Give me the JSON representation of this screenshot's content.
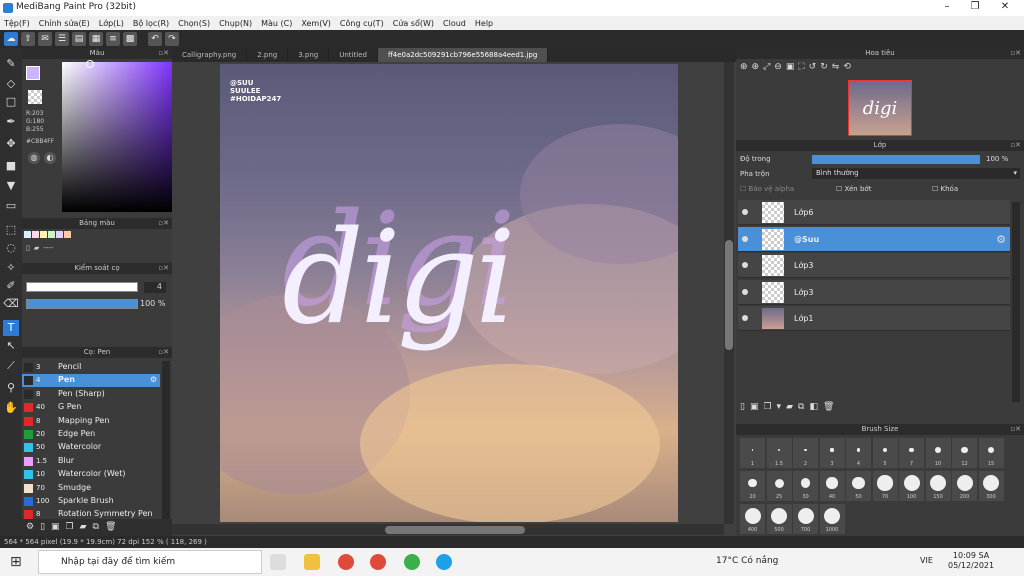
{
  "window": {
    "title": "MediBang Paint Pro (32bit)",
    "min": "–",
    "max": "❐",
    "close": "✕"
  },
  "menu": [
    "Tệp(F)",
    "Chỉnh sửa(E)",
    "Lớp(L)",
    "Bộ lọc(R)",
    "Chọn(S)",
    "Chụp(N)",
    "Màu (C)",
    "Xem(V)",
    "Công cụ(T)",
    "Cửa sổ(W)",
    "Cloud",
    "Help"
  ],
  "colorPanel": {
    "title": "Màu",
    "r": "R:203",
    "g": "G:180",
    "b": "B:255",
    "hex": "#CBB4FF",
    "fg": "#CBB4FF",
    "bg": "#F4A37A"
  },
  "palette": {
    "title": "Bảng màu",
    "colors": [
      "#d9f0ff",
      "#ffd9e8",
      "#fff3b0",
      "#c8f7c5",
      "#e2d1ff",
      "#ffc9a8"
    ],
    "more": "----"
  },
  "brushControl": {
    "title": "Kiểm soát cọ",
    "size": "4",
    "opacity": "100 %"
  },
  "penList": {
    "title": "Cọ: Pen",
    "items": [
      {
        "size": "3",
        "name": "Pencil",
        "color": "#2a2a2a"
      },
      {
        "size": "4",
        "name": "Pen",
        "color": "#2a2a2a"
      },
      {
        "size": "8",
        "name": "Pen (Sharp)",
        "color": "#2a2a2a"
      },
      {
        "size": "40",
        "name": "G Pen",
        "color": "#e02a2a"
      },
      {
        "size": "8",
        "name": "Mapping Pen",
        "color": "#e02a2a"
      },
      {
        "size": "20",
        "name": "Edge Pen",
        "color": "#1e9e3a"
      },
      {
        "size": "50",
        "name": "Watercolor",
        "color": "#2ec4e8"
      },
      {
        "size": "1.5",
        "name": "Blur",
        "color": "#e8a0ff"
      },
      {
        "size": "10",
        "name": "Watercolor (Wet)",
        "color": "#2ec4e8"
      },
      {
        "size": "70",
        "name": "Smudge",
        "color": "#f2e0c8"
      },
      {
        "size": "100",
        "name": "Sparkle Brush",
        "color": "#2a6ad4"
      },
      {
        "size": "8",
        "name": "Rotation Symmetry Pen",
        "color": "#e02a2a"
      }
    ]
  },
  "tabs": [
    "Calligraphy.png",
    "2.png",
    "3.png",
    "Untitled",
    "ff4e0a2dc509291cb796e55688a4eed1.jpg"
  ],
  "artwork": {
    "text": "digi",
    "watermark1": "@SUU",
    "watermark2": "SUULEE",
    "watermark3": "#HOIDAP247"
  },
  "navigator": {
    "title": "Hoa tiêu"
  },
  "layers": {
    "title": "Lớp",
    "opacityLabel": "Độ trong",
    "opacityValue": "100 %",
    "blendLabel": "Pha trộn",
    "blendValue": "Bình thường",
    "protectAlpha": "Bảo vệ alpha",
    "clipping": "Xén bớt",
    "lock": "Khóa",
    "items": [
      {
        "name": "Lớp6",
        "selected": false
      },
      {
        "name": "@Suu",
        "selected": true
      },
      {
        "name": "Lớp3",
        "selected": false
      },
      {
        "name": "Lớp3",
        "selected": false
      },
      {
        "name": "Lớp1",
        "selected": false
      }
    ]
  },
  "brushSize": {
    "title": "Brush Size",
    "row1": [
      "1",
      "1.5",
      "2",
      "3",
      "4",
      "5",
      "7",
      "10",
      "12",
      "15"
    ],
    "row2": [
      "20",
      "25",
      "30",
      "40",
      "50",
      "70",
      "100",
      "150",
      "200",
      "300"
    ],
    "row3": [
      "400",
      "500",
      "700",
      "1000"
    ]
  },
  "status": {
    "text": "564 * 564 pixel   (19.9 * 19.9cm)   72 dpi   152 %   ( 118, 269 )"
  },
  "taskbar": {
    "search": "Nhập tại đây để tìm kiếm",
    "weather": "17°C  Có nắng",
    "lang": "VIE",
    "time": "10:09 SA",
    "date": "05/12/2021"
  }
}
